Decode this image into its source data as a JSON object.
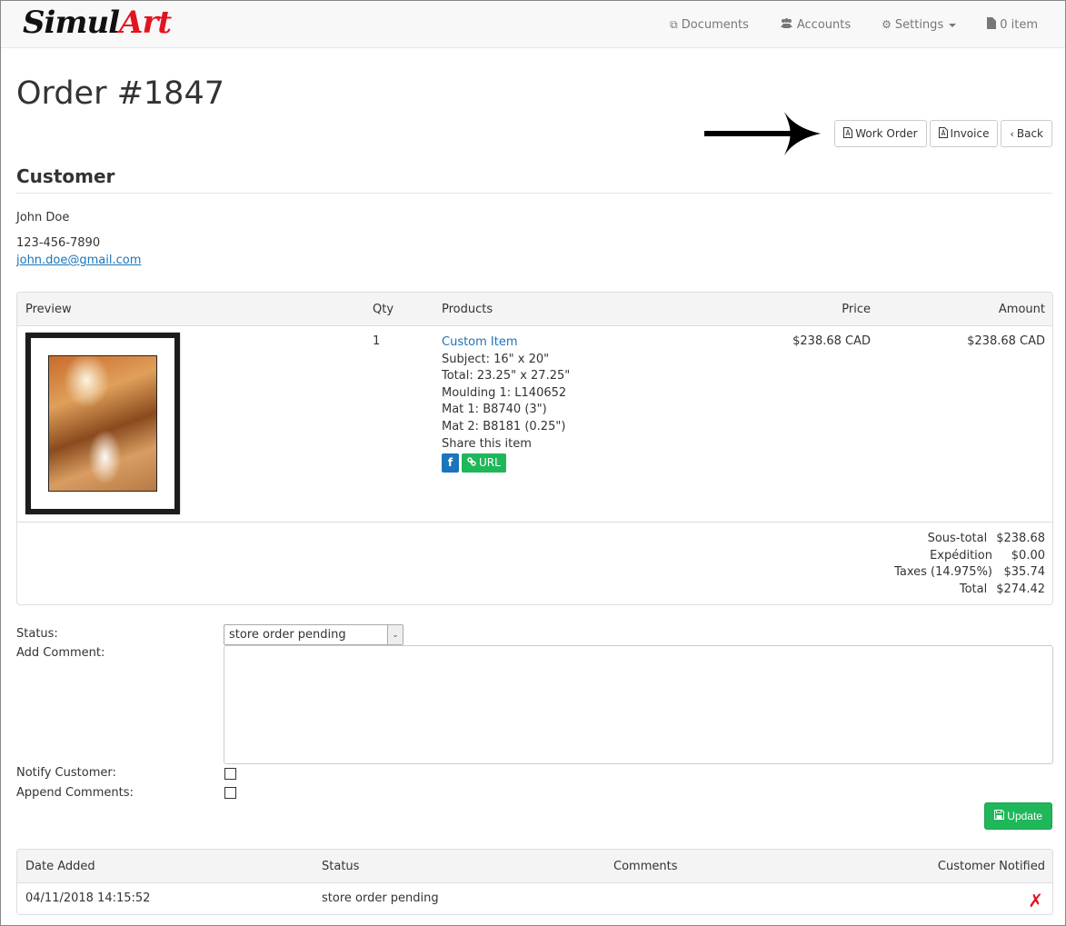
{
  "brand": {
    "logo_part1": "Simul",
    "logo_part2": "Art",
    "accent_color": "#e2141f"
  },
  "nav": {
    "items": [
      {
        "label": "Documents",
        "icon": "documents-icon"
      },
      {
        "label": "Accounts",
        "icon": "users-icon"
      },
      {
        "label": "Settings",
        "icon": "gear-icon",
        "dropdown": true
      },
      {
        "label": "0 item",
        "icon": "file-icon"
      }
    ]
  },
  "page": {
    "title": "Order #1847"
  },
  "actions": {
    "work_order": "Work Order",
    "invoice": "Invoice",
    "back": "Back"
  },
  "customer": {
    "heading": "Customer",
    "name": "John Doe",
    "phone": "123-456-7890",
    "email": "john.doe@gmail.com"
  },
  "order_table": {
    "headers": {
      "preview": "Preview",
      "qty": "Qty",
      "products": "Products",
      "price": "Price",
      "amount": "Amount"
    },
    "items": [
      {
        "qty": "1",
        "product_name": "Custom Item",
        "details": [
          "Subject: 16\" x 20\"",
          "Total: 23.25\" x 27.25\"",
          "Moulding 1: L140652",
          "Mat 1: B8740 (3\")",
          "Mat 2: B8181 (0.25\")"
        ],
        "share_label": "Share this item",
        "share_facebook": "f",
        "share_url": "URL",
        "price": "$238.68 CAD",
        "amount": "$238.68 CAD"
      }
    ],
    "totals": [
      {
        "label": "Sous-total",
        "value": "$238.68"
      },
      {
        "label": "Expédition",
        "value": "$0.00"
      },
      {
        "label": "Taxes (14.975%)",
        "value": "$35.74"
      },
      {
        "label": "Total",
        "value": "$274.42"
      }
    ]
  },
  "status_form": {
    "status_label": "Status:",
    "status_value": "store order pending",
    "comment_label": "Add Comment:",
    "comment_value": "",
    "notify_label": "Notify Customer:",
    "notify_checked": false,
    "append_label": "Append Comments:",
    "append_checked": false,
    "update_button": "Update"
  },
  "history": {
    "headers": {
      "date": "Date Added",
      "status": "Status",
      "comments": "Comments",
      "notified": "Customer Notified"
    },
    "rows": [
      {
        "date": "04/11/2018 14:15:52",
        "status": "store order pending",
        "comments": "",
        "notified": "✗"
      }
    ]
  }
}
